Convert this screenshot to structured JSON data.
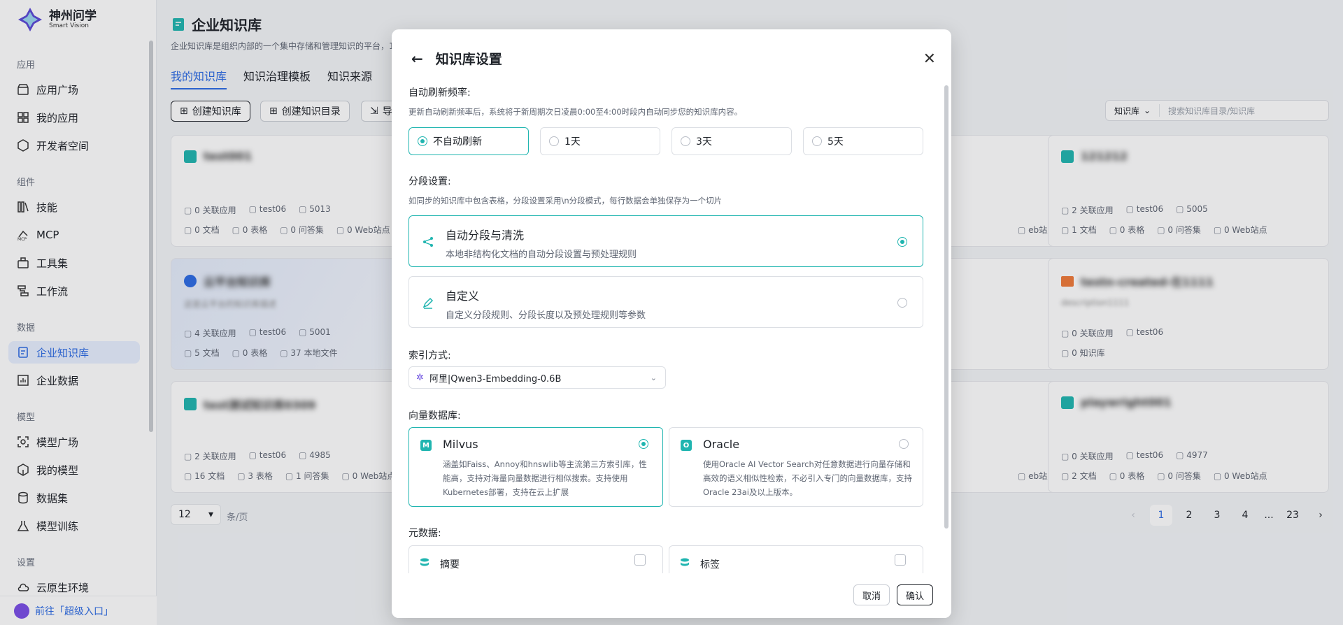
{
  "app": {
    "name": "神州问学",
    "sub": "Smart Vision"
  },
  "sidebar": {
    "sections": [
      "应用",
      "组件",
      "数据",
      "模型",
      "设置"
    ],
    "items": [
      "应用广场",
      "我的应用",
      "开发者空间",
      "技能",
      "MCP",
      "工具集",
      "工作流",
      "企业知识库",
      "企业数据",
      "模型广场",
      "我的模型",
      "数据集",
      "模型训练",
      "云原生环境"
    ],
    "footer": "前往「超级入口」"
  },
  "page": {
    "title": "企业知识库",
    "desc": "企业知识库是组织内部的一个集中存储和管理知识的平台，1",
    "tabs": [
      "我的知识库",
      "知识治理模板",
      "知识来源"
    ],
    "buttons": {
      "create_kb": "创建知识库",
      "create_dir": "创建知识目录",
      "import": "导"
    },
    "search": {
      "scope": "知识库",
      "placeholder": "搜索知识库目录/知识库"
    }
  },
  "cards": [
    {
      "name": "test001",
      "row1": [
        "0 关联应用",
        "test06",
        "5013"
      ],
      "row2": [
        "0 文档",
        "0 表格",
        "0 问答集",
        "0 Web站点"
      ]
    },
    {
      "name": "云平台知识库",
      "desc": "这是云平台的知识库描述",
      "row1": [
        "4 关联应用",
        "test06",
        "5001"
      ],
      "row2": [
        "5 文档",
        "0 表格",
        "37 本地文件"
      ]
    },
    {
      "name": "test测试知识库0309",
      "row1": [
        "2 关联应用",
        "test06",
        "4985"
      ],
      "row2": [
        "16 文档",
        "3 表格",
        "1 问答集",
        "0 Web站点"
      ]
    },
    {
      "name": "121212",
      "row1": [
        "2 关联应用",
        "test06",
        "5005"
      ],
      "row2": [
        "1 文档",
        "0 表格",
        "0 问答集",
        "0 Web站点"
      ]
    },
    {
      "name": "testn-created-在1111",
      "desc": "description1111",
      "row1": [
        "0 关联应用",
        "test06"
      ],
      "row2": [
        "0 知识库"
      ]
    },
    {
      "name": "playwright001",
      "row1": [
        "0 关联应用",
        "test06",
        "4977"
      ],
      "row2": [
        "2 文档",
        "0 表格",
        "0 问答集",
        "0 Web站点"
      ]
    },
    {
      "partial": "eb站点"
    }
  ],
  "pagination": {
    "size": "12",
    "unit": "条/页",
    "pages": [
      "1",
      "2",
      "3",
      "4",
      "...",
      "23"
    ]
  },
  "modal": {
    "title": "知识库设置",
    "refresh": {
      "label": "自动刷新频率:",
      "hint": "更新自动刷新频率后，系统将于新周期次日凌晨0:00至4:00时段内自动同步您的知识库内容。",
      "options": [
        "不自动刷新",
        "1天",
        "3天",
        "5天"
      ]
    },
    "segment": {
      "label": "分段设置:",
      "hint": "如同步的知识库中包含表格，分段设置采用\\n分段模式，每行数据会单独保存为一个切片",
      "options": [
        {
          "title": "自动分段与清洗",
          "desc": "本地非结构化文档的自动分段设置与预处理规则"
        },
        {
          "title": "自定义",
          "desc": "自定义分段规则、分段长度以及预处理规则等参数"
        }
      ]
    },
    "index": {
      "label": "索引方式:",
      "value": "阿里|Qwen3-Embedding-0.6B"
    },
    "vector": {
      "label": "向量数据库:",
      "options": [
        {
          "title": "Milvus",
          "desc": "涵盖如Faiss、Annoy和hnswlib等主流第三方索引库，性能高，支持对海量向量数据进行相似搜索。支持使用Kubernetes部署，支持在云上扩展"
        },
        {
          "title": "Oracle",
          "desc": "使用Oracle AI Vector Search对任意数据进行向量存储和高效的语义相似性检索，不必引入专门的向量数据库，支持Oracle 23ai及以上版本。"
        }
      ]
    },
    "metadata": {
      "label": "元数据:",
      "options": [
        "摘要",
        "标签"
      ]
    },
    "cancel": "取消",
    "confirm": "确认"
  },
  "colors": {
    "accent": "#20b5b0",
    "brand": "#2d6be4"
  }
}
